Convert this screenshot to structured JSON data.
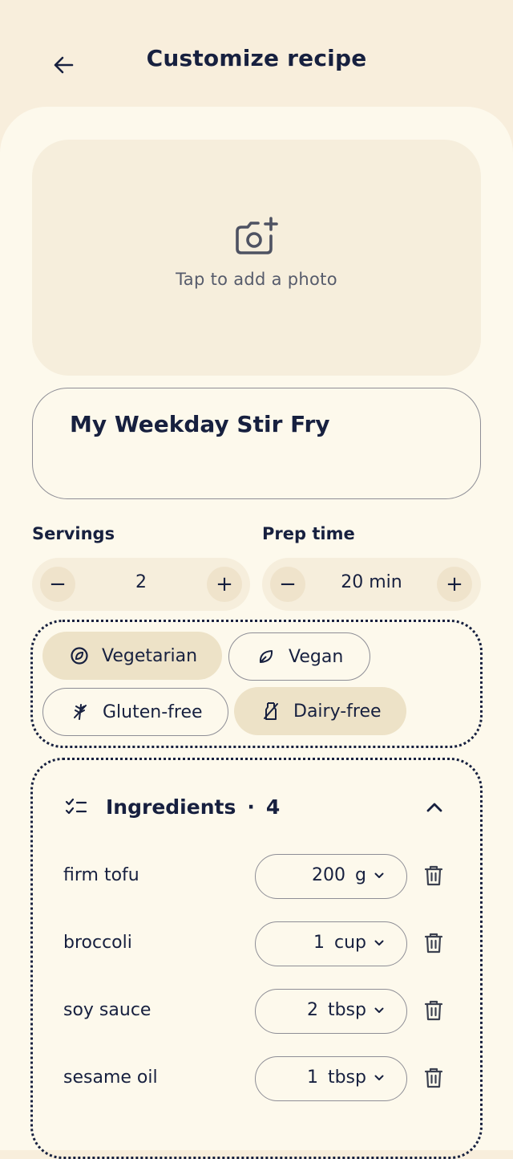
{
  "header": {
    "title": "Customize recipe"
  },
  "photo": {
    "prompt": "Tap to add a photo"
  },
  "recipe": {
    "name": "My Weekday Stir Fry"
  },
  "servings": {
    "label": "Servings",
    "value": "2"
  },
  "prep": {
    "label": "Prep time",
    "value": "20 min"
  },
  "stepper": {
    "minus": "−",
    "plus": "+"
  },
  "diet": [
    {
      "label": "Vegetarian",
      "selected": true
    },
    {
      "label": "Vegan",
      "selected": false
    },
    {
      "label": "Gluten-free",
      "selected": false
    },
    {
      "label": "Dairy-free",
      "selected": true
    }
  ],
  "ingredients": {
    "title": "Ingredients",
    "separator": "·",
    "count": "4",
    "items": [
      {
        "name": "firm tofu",
        "qty": "200",
        "unit": "g"
      },
      {
        "name": "broccoli",
        "qty": "1",
        "unit": "cup"
      },
      {
        "name": "soy sauce",
        "qty": "2",
        "unit": "tbsp"
      },
      {
        "name": "sesame oil",
        "qty": "1",
        "unit": "tbsp"
      }
    ]
  },
  "colors": {
    "ink": "#17203F",
    "background": "#F8EEDC",
    "sheet": "#FDF9EC",
    "chip_selected": "#EDE2C7"
  }
}
